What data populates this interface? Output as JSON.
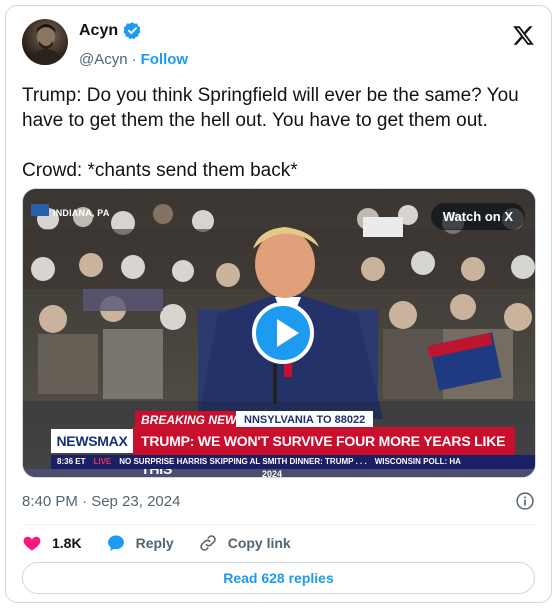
{
  "author": {
    "name": "Acyn",
    "handle": "@Acyn",
    "separator": "·",
    "follow_label": "Follow"
  },
  "tweet": {
    "text": "Trump: Do you think Springfield will ever be the same? You have to get them the hell out. You have to get them out.\n\nCrowd: *chants send them back*",
    "timestamp": "8:40 PM · Sep 23, 2024"
  },
  "media": {
    "watch_label": "Watch on X",
    "location": "INDIANA, PA",
    "breaking": "BREAKING NEWS",
    "state_bar": "NNSYLVANIA TO 88022",
    "network": "NEWSMAX",
    "headline": "TRUMP: WE WON'T SURVIVE FOUR MORE YEARS LIKE THIS",
    "ticker_time": "8:36 ET",
    "ticker_live": "LIVE",
    "ticker_text_1": "NO SURPRISE HARRIS SKIPPING AL SMITH DINNER: TRUMP . . .",
    "ticker_text_2": "WISCONSIN POLL: HA",
    "year": "2024"
  },
  "actions": {
    "likes": "1.8K",
    "reply": "Reply",
    "copy": "Copy link",
    "read_replies": "Read 628 replies"
  },
  "colors": {
    "accent": "#1d9bf0",
    "like": "#f91880",
    "text_secondary": "#536471",
    "breaking_red": "#c8102e"
  },
  "icons": [
    "verified-badge-icon",
    "x-logo-icon",
    "play-icon",
    "info-icon",
    "heart-icon",
    "reply-bubble-icon",
    "link-icon"
  ]
}
